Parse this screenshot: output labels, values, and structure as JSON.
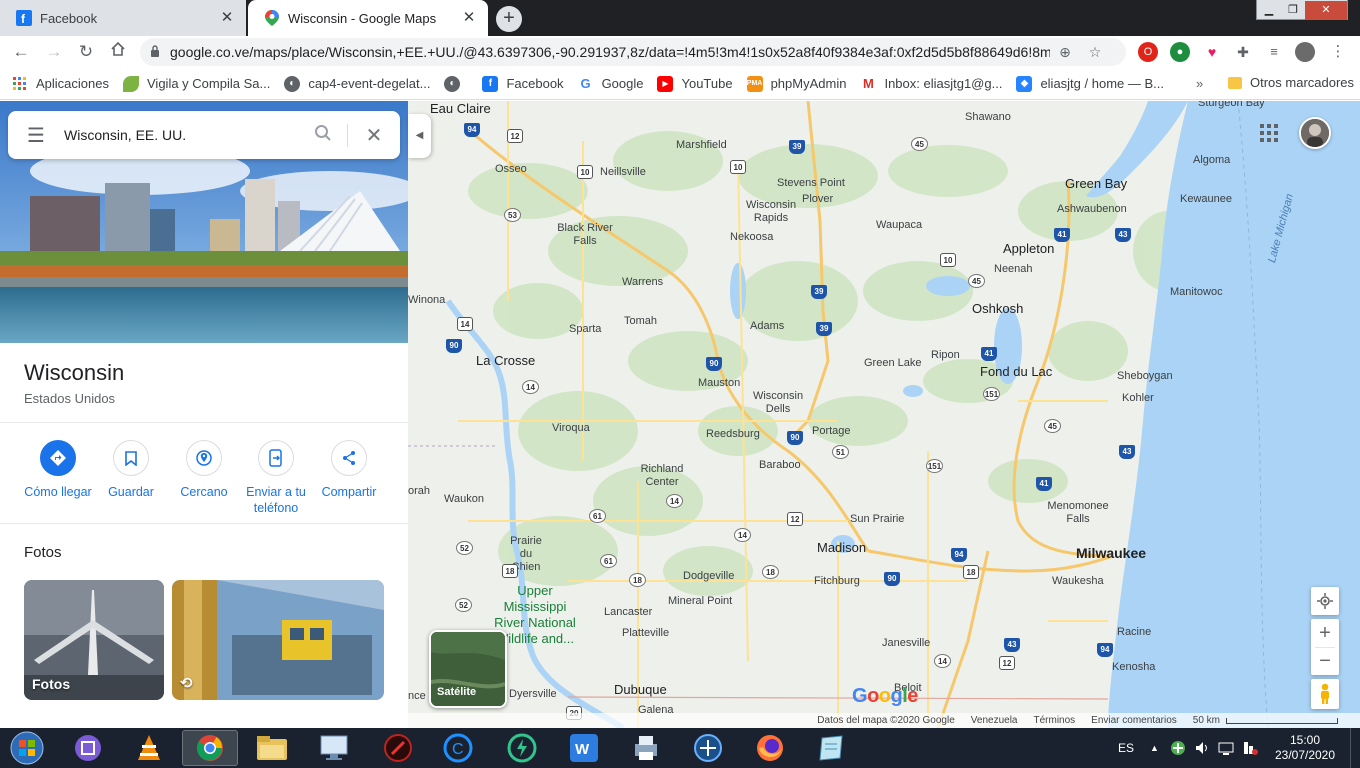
{
  "browser": {
    "tabs": [
      {
        "title": "Facebook",
        "active": false
      },
      {
        "title": "Wisconsin - Google Maps",
        "active": true
      }
    ],
    "url": "google.co.ve/maps/place/Wisconsin,+EE.+UU./@43.6397306,-90.291937,8z/data=!4m5!3m4!1s0x52a8f40f9384e3af:0xf2d5d5b8f88649d6!8m...",
    "bookmarks": [
      {
        "label": "Aplicaciones",
        "icon": "apps-grid-icon"
      },
      {
        "label": "Vigila y Compila Sa...",
        "icon": "leaf-icon"
      },
      {
        "label": "cap4-event-degelat...",
        "icon": "globe-icon"
      },
      {
        "label": "",
        "icon": "globe-icon"
      },
      {
        "label": "Facebook",
        "icon": "facebook-icon"
      },
      {
        "label": "Google",
        "icon": "google-icon"
      },
      {
        "label": "YouTube",
        "icon": "youtube-icon"
      },
      {
        "label": "phpMyAdmin",
        "icon": "phpmyadmin-icon"
      },
      {
        "label": "Inbox: eliasjtg1@g...",
        "icon": "gmail-icon"
      },
      {
        "label": "eliasjtg / home — B...",
        "icon": "bitbucket-icon"
      }
    ],
    "bookmarks_more": "»",
    "other_bookmarks": "Otros marcadores"
  },
  "panel": {
    "search_query": "Wisconsin, EE. UU.",
    "place_title": "Wisconsin",
    "place_subtitle": "Estados Unidos",
    "actions": [
      {
        "label": "Cómo llegar",
        "icon": "directions-icon"
      },
      {
        "label": "Guardar",
        "icon": "bookmark-icon"
      },
      {
        "label": "Cercano",
        "icon": "nearby-icon"
      },
      {
        "label": "Enviar a tu teléfono",
        "icon": "send-to-phone-icon"
      },
      {
        "label": "Compartir",
        "icon": "share-icon"
      }
    ],
    "photos_title": "Fotos",
    "photos": [
      {
        "label": "Fotos"
      },
      {
        "label": ""
      }
    ]
  },
  "map": {
    "cities": [
      {
        "name": "Eau Claire",
        "style": "big"
      },
      {
        "name": "Shawano",
        "style": ""
      },
      {
        "name": "Marshfield",
        "style": ""
      },
      {
        "name": "Osseo",
        "style": ""
      },
      {
        "name": "Neillsville",
        "style": ""
      },
      {
        "name": "Stevens Point",
        "style": ""
      },
      {
        "name": "Plover",
        "style": ""
      },
      {
        "name": "Green Bay",
        "style": "big"
      },
      {
        "name": "Algoma",
        "style": ""
      },
      {
        "name": "Ashwaubenon",
        "style": ""
      },
      {
        "name": "Kewaunee",
        "style": ""
      },
      {
        "name": "Wisconsin Rapids",
        "style": ""
      },
      {
        "name": "Waupaca",
        "style": ""
      },
      {
        "name": "Black River Falls",
        "style": ""
      },
      {
        "name": "Nekoosa",
        "style": ""
      },
      {
        "name": "Appleton",
        "style": "big"
      },
      {
        "name": "Neenah",
        "style": ""
      },
      {
        "name": "Warrens",
        "style": ""
      },
      {
        "name": "Manitowoc",
        "style": ""
      },
      {
        "name": "Winona",
        "style": ""
      },
      {
        "name": "Oshkosh",
        "style": "big"
      },
      {
        "name": "Sparta",
        "style": ""
      },
      {
        "name": "Tomah",
        "style": ""
      },
      {
        "name": "Adams",
        "style": ""
      },
      {
        "name": "La Crosse",
        "style": "big"
      },
      {
        "name": "Green Lake",
        "style": ""
      },
      {
        "name": "Ripon",
        "style": ""
      },
      {
        "name": "Fond du Lac",
        "style": "big"
      },
      {
        "name": "Sheboygan",
        "style": ""
      },
      {
        "name": "Mauston",
        "style": ""
      },
      {
        "name": "Wisconsin Dells",
        "style": ""
      },
      {
        "name": "Kohler",
        "style": ""
      },
      {
        "name": "Viroqua",
        "style": ""
      },
      {
        "name": "Reedsburg",
        "style": ""
      },
      {
        "name": "Portage",
        "style": ""
      },
      {
        "name": "Baraboo",
        "style": ""
      },
      {
        "name": "Richland Center",
        "style": ""
      },
      {
        "name": "Waukon",
        "style": ""
      },
      {
        "name": "Menomonee Falls",
        "style": ""
      },
      {
        "name": "Sun Prairie",
        "style": ""
      },
      {
        "name": "Prairie du Chien",
        "style": ""
      },
      {
        "name": "Madison",
        "style": "big"
      },
      {
        "name": "Milwaukee",
        "style": "bold"
      },
      {
        "name": "Dodgeville",
        "style": ""
      },
      {
        "name": "Fitchburg",
        "style": ""
      },
      {
        "name": "Waukesha",
        "style": ""
      },
      {
        "name": "Mineral Point",
        "style": ""
      },
      {
        "name": "Lancaster",
        "style": ""
      },
      {
        "name": "Platteville",
        "style": ""
      },
      {
        "name": "Janesville",
        "style": ""
      },
      {
        "name": "Racine",
        "style": ""
      },
      {
        "name": "Kenosha",
        "style": ""
      },
      {
        "name": "Dyersville",
        "style": ""
      },
      {
        "name": "Dubuque",
        "style": "big"
      },
      {
        "name": "Beloit",
        "style": ""
      },
      {
        "name": "Galena",
        "style": ""
      },
      {
        "name": "Sturgeon Bay",
        "style": ""
      },
      {
        "name": "orah",
        "style": ""
      },
      {
        "name": "nce",
        "style": ""
      }
    ],
    "park_label": "Upper Mississippi River National Wildlife and...",
    "lake_label": "Lake Michigan",
    "satellite_label": "Satélite",
    "google_logo": "Google",
    "attribution": [
      "Datos del mapa ©2020 Google",
      "Venezuela",
      "Términos",
      "Enviar comentarios",
      "50 km"
    ],
    "zoom_in": "+",
    "zoom_out": "−"
  },
  "taskbar": {
    "language": "ES",
    "time": "15:00",
    "date": "23/07/2020"
  }
}
